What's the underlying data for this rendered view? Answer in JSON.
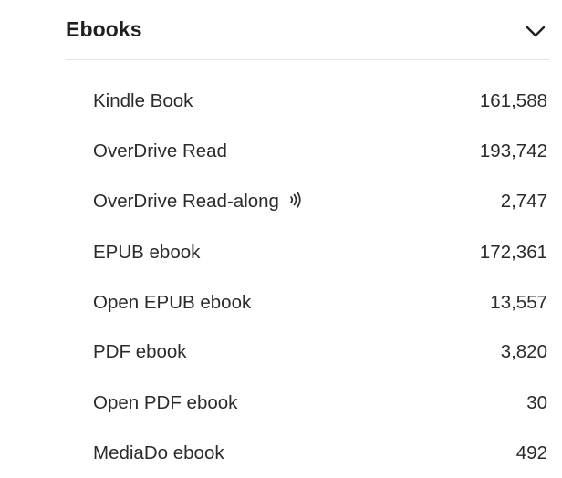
{
  "section": {
    "title": "Ebooks",
    "toggle_icon": "chevron-down-icon"
  },
  "items": [
    {
      "label": "Kindle Book",
      "count": "161,588"
    },
    {
      "label": "OverDrive Read",
      "count": "193,742"
    },
    {
      "label": "OverDrive Read-along",
      "count": "2,747",
      "icon": "read-along-audio-icon"
    },
    {
      "label": "EPUB ebook",
      "count": "172,361"
    },
    {
      "label": "Open EPUB ebook",
      "count": "13,557"
    },
    {
      "label": "PDF ebook",
      "count": "3,820"
    },
    {
      "label": "Open PDF ebook",
      "count": "30"
    },
    {
      "label": "MediaDo ebook",
      "count": "492"
    }
  ],
  "colors": {
    "text": "#222222",
    "divider": "#e3e3e3"
  }
}
